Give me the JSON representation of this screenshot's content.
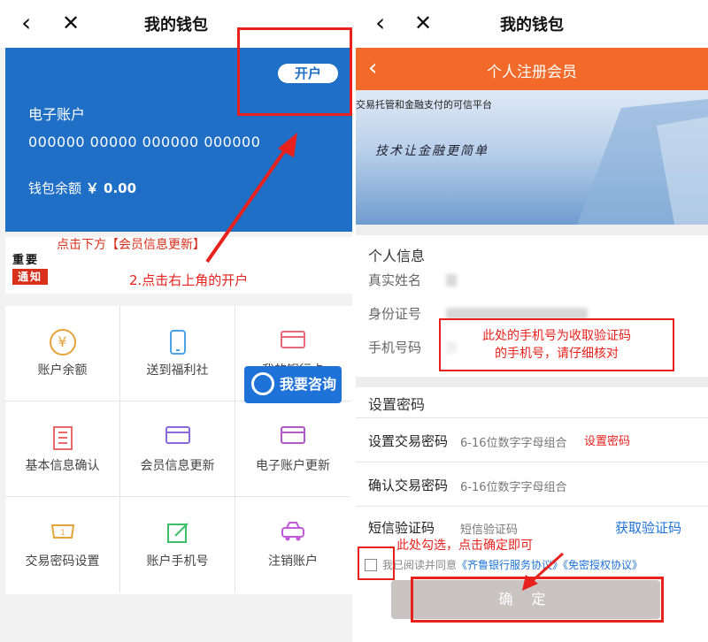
{
  "left": {
    "nav": {
      "back_icon": "chevron-left-icon",
      "close_icon": "close-icon",
      "title": "我的钱包"
    },
    "card": {
      "open_button": "开户",
      "account_label": "电子账户",
      "account_number": "000000 00000 000000 000000",
      "balance_label": "钱包余额",
      "balance_value": "￥ 0.00"
    },
    "notice": {
      "badge_top": "重要",
      "badge_bottom": "通知",
      "text": "点击下方【会员信息更新】",
      "step_instruction": "2.点击右上角的开户"
    },
    "grid": [
      {
        "label": "账户余额",
        "icon": "yen-coin-icon"
      },
      {
        "label": "送到福利社",
        "icon": "phone-icon"
      },
      {
        "label": "我的银行卡",
        "icon": "bank-card-icon"
      },
      {
        "label": "基本信息确认",
        "icon": "building-icon"
      },
      {
        "label": "会员信息更新",
        "icon": "card-icon"
      },
      {
        "label": "电子账户更新",
        "icon": "card-edit-icon"
      },
      {
        "label": "交易密码设置",
        "icon": "lock-box-icon"
      },
      {
        "label": "账户手机号",
        "icon": "edit-icon"
      },
      {
        "label": "注销账户",
        "icon": "car-icon"
      }
    ],
    "consult_button": "我要咨询",
    "colors": {
      "card_blue": "#1f6fc6",
      "annotation_red": "#e8211d"
    }
  },
  "right": {
    "nav": {
      "back_icon": "chevron-left-icon",
      "close_icon": "close-icon",
      "title": "我的钱包"
    },
    "header": {
      "title": "个人注册会员"
    },
    "banner": {
      "tagline": "交易托管和金融支付的可信平台",
      "slogan": "技术让金融更简单"
    },
    "personal": {
      "heading": "个人信息",
      "name_label": "真实姓名",
      "id_label": "身份证号",
      "phone_label": "手机号码"
    },
    "phone_callout": [
      "此处的手机号为收取验证码",
      "的手机号，请仔细核对"
    ],
    "password": {
      "heading": "设置密码",
      "set_label": "设置交易密码",
      "set_hint": "6-16位数字字母组合",
      "set_annotation": "设置密码",
      "confirm_label": "确认交易密码",
      "confirm_hint": "6-16位数字字母组合",
      "sms_label": "短信验证码",
      "sms_placeholder": "短信验证码",
      "get_code": "获取验证码"
    },
    "check_tip": "此处勾选，点击确定即可",
    "agreement": {
      "prefix": "我已阅读并同意",
      "link1": "《齐鲁银行服务协议》",
      "link2": "《免密授权协议》"
    },
    "confirm_button": "确 定",
    "colors": {
      "header_orange": "#f26a2a",
      "link_blue": "#1e72d8",
      "confirm_gray": "#c9c4c2"
    }
  }
}
